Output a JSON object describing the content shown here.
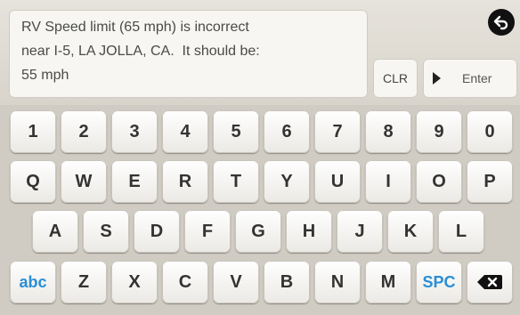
{
  "message": {
    "text": "RV Speed limit (65 mph) is incorrect\nnear I-5, LA JOLLA, CA.  It should be:\n55 mph"
  },
  "buttons": {
    "back_icon": "back-arrow-icon",
    "clear_label": "CLR",
    "enter_label": "Enter"
  },
  "keyboard": {
    "row1": [
      "1",
      "2",
      "3",
      "4",
      "5",
      "6",
      "7",
      "8",
      "9",
      "0"
    ],
    "row2": [
      "Q",
      "W",
      "E",
      "R",
      "T",
      "Y",
      "U",
      "I",
      "O",
      "P"
    ],
    "row3": [
      "A",
      "S",
      "D",
      "F",
      "G",
      "H",
      "J",
      "K",
      "L"
    ],
    "row4": [
      "Z",
      "X",
      "C",
      "V",
      "B",
      "N",
      "M"
    ],
    "abc_label": "abc",
    "space_label": "SPC",
    "backspace_icon": "backspace-icon"
  },
  "colors": {
    "special_key_text": "#2a8ed6"
  }
}
